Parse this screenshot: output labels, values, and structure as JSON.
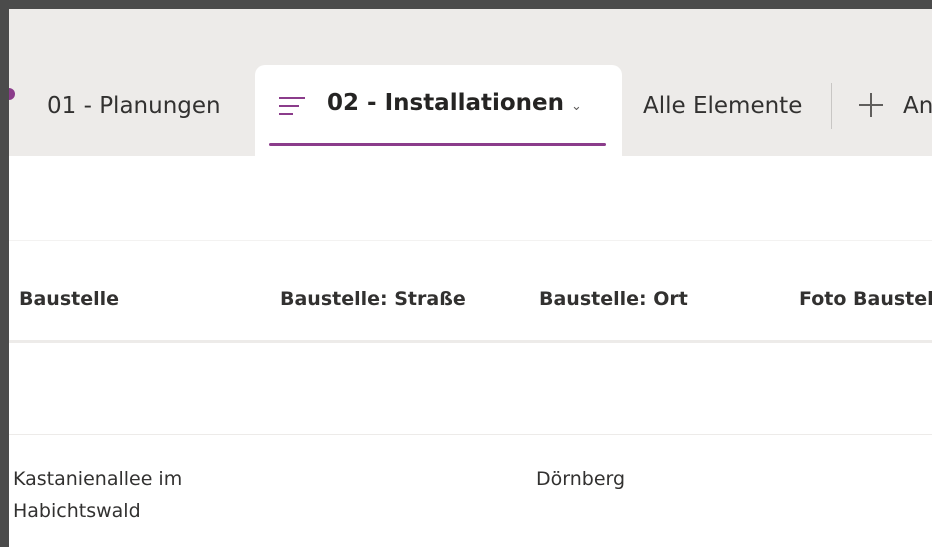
{
  "tabs": {
    "planungen": "01 - Planungen",
    "installationen": "02 - Installationen",
    "alle_elemente": "Alle Elemente",
    "add_label": "An",
    "icons": {
      "menu": "menu-lines-icon",
      "chevron": "chevron-down-icon",
      "add": "plus-icon"
    }
  },
  "table": {
    "columns": [
      "Baustelle",
      "Baustelle: Straße",
      "Baustelle: Ort",
      "Foto Baustel"
    ],
    "rows": [
      {
        "baustelle_line1": "Kastanienallee im",
        "baustelle_line2": "Habichtswald",
        "strasse": "",
        "ort": "Dörnberg",
        "foto": ""
      }
    ]
  },
  "colors": {
    "accent": "#8b3c8b",
    "tabbar_bg": "#edebe9",
    "frame": "#4b4b4b"
  }
}
